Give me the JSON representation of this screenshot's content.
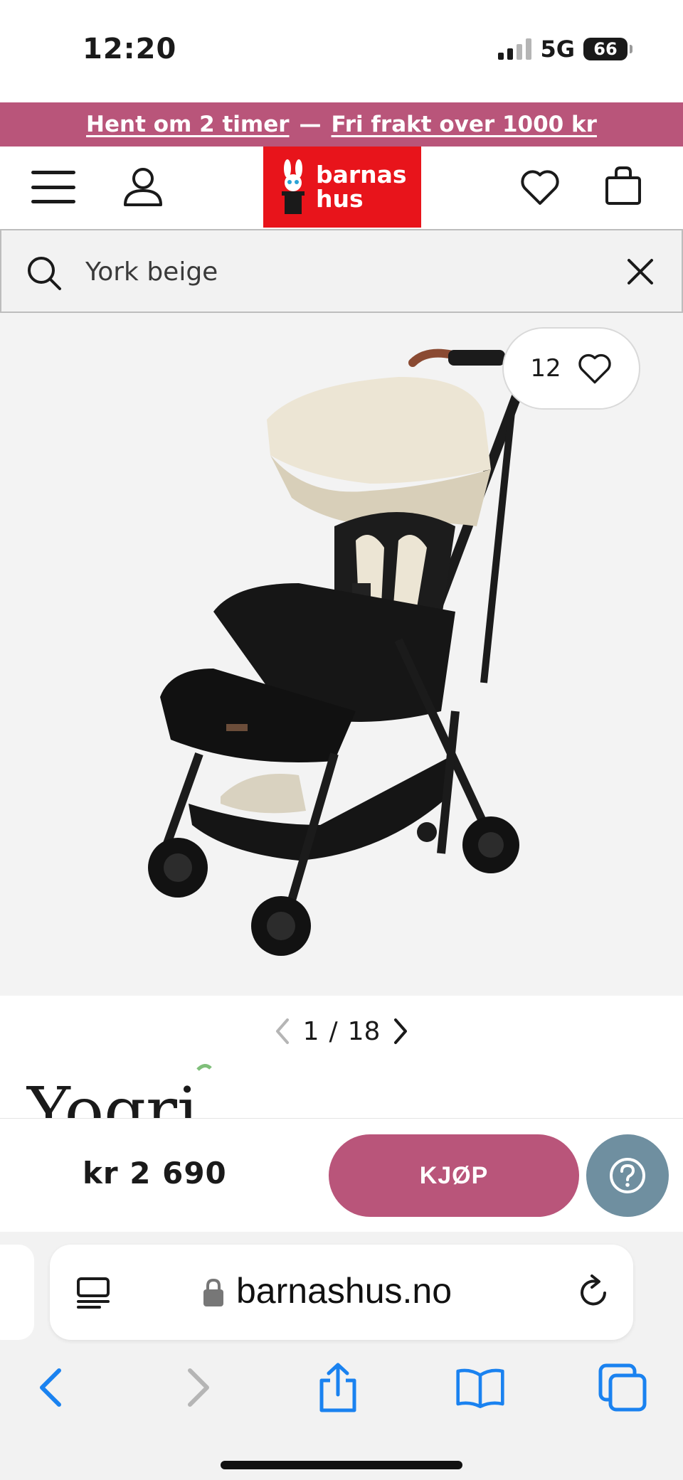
{
  "status_bar": {
    "time": "12:20",
    "network": "5G",
    "battery": "66"
  },
  "promo": {
    "link1": "Hent om 2 timer",
    "separator": "—",
    "link2": "Fri frakt over 1000 kr"
  },
  "header": {
    "logo_line1": "barnas",
    "logo_line2": "hus"
  },
  "search": {
    "value": "York beige"
  },
  "product": {
    "favorites_count": "12",
    "page_current": "1",
    "page_separator": "/",
    "page_total": "18",
    "brand": "Yogri"
  },
  "buy_bar": {
    "price": "kr 2 690",
    "buy_label": "KJØP"
  },
  "browser": {
    "url": "barnashus.no"
  },
  "colors": {
    "brand_pink": "#b9557a",
    "logo_red": "#e8141b",
    "help_blue": "#6f8fa0",
    "ios_blue": "#1a82f0"
  }
}
